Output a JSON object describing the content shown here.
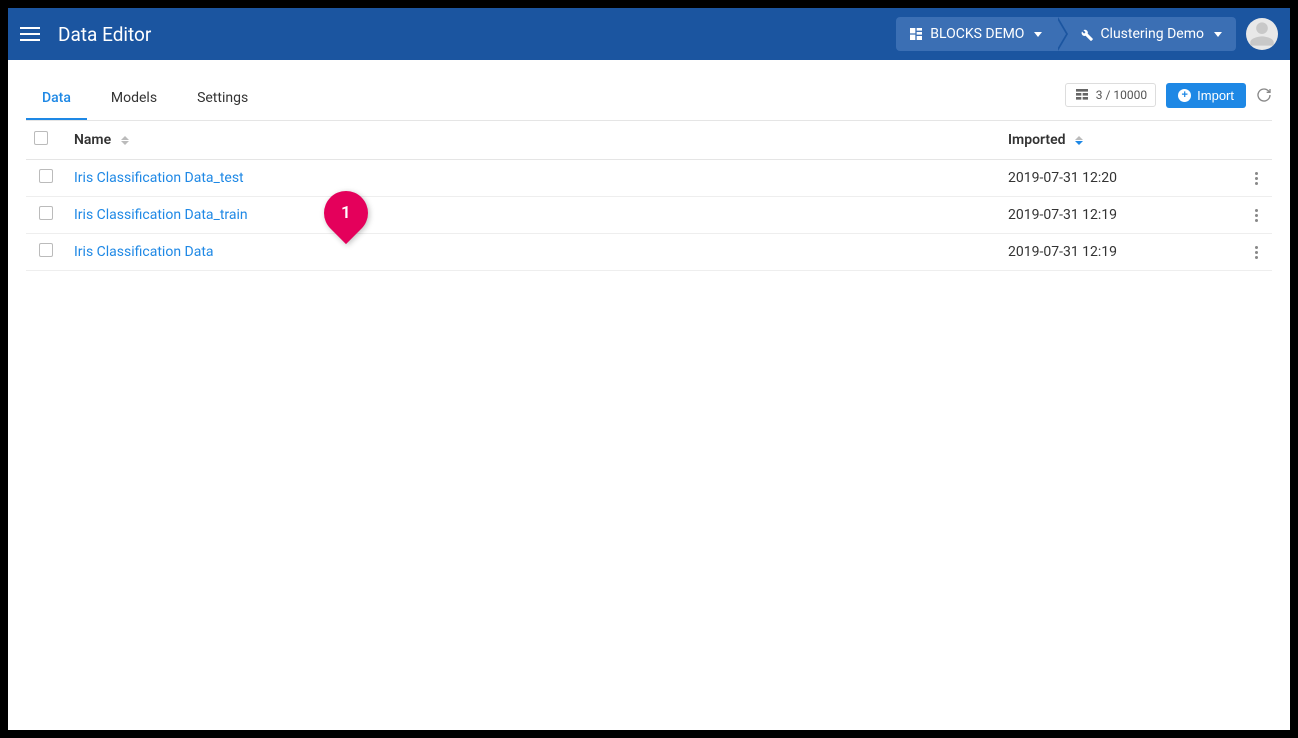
{
  "app": {
    "title": "Data Editor"
  },
  "breadcrumb": {
    "org": {
      "label": "BLOCKS DEMO",
      "icon": "org-icon"
    },
    "project": {
      "label": "Clustering Demo",
      "icon": "wrench-icon"
    }
  },
  "tabs": [
    {
      "id": "data",
      "label": "Data",
      "active": true
    },
    {
      "id": "models",
      "label": "Models",
      "active": false
    },
    {
      "id": "settings",
      "label": "Settings",
      "active": false
    }
  ],
  "toolbar": {
    "count_label": "3 / 10000",
    "import_label": "Import"
  },
  "table": {
    "headers": {
      "name": "Name",
      "imported": "Imported"
    },
    "sort": {
      "column": "imported",
      "dir": "desc"
    },
    "rows": [
      {
        "name": "Iris Classification Data_test",
        "imported": "2019-07-31 12:20"
      },
      {
        "name": "Iris Classification Data_train",
        "imported": "2019-07-31 12:19",
        "callout": "1"
      },
      {
        "name": "Iris Classification Data",
        "imported": "2019-07-31 12:19"
      }
    ]
  },
  "colors": {
    "brand": "#1b55a0",
    "accent": "#1e88e5",
    "callout": "#e4005b"
  }
}
